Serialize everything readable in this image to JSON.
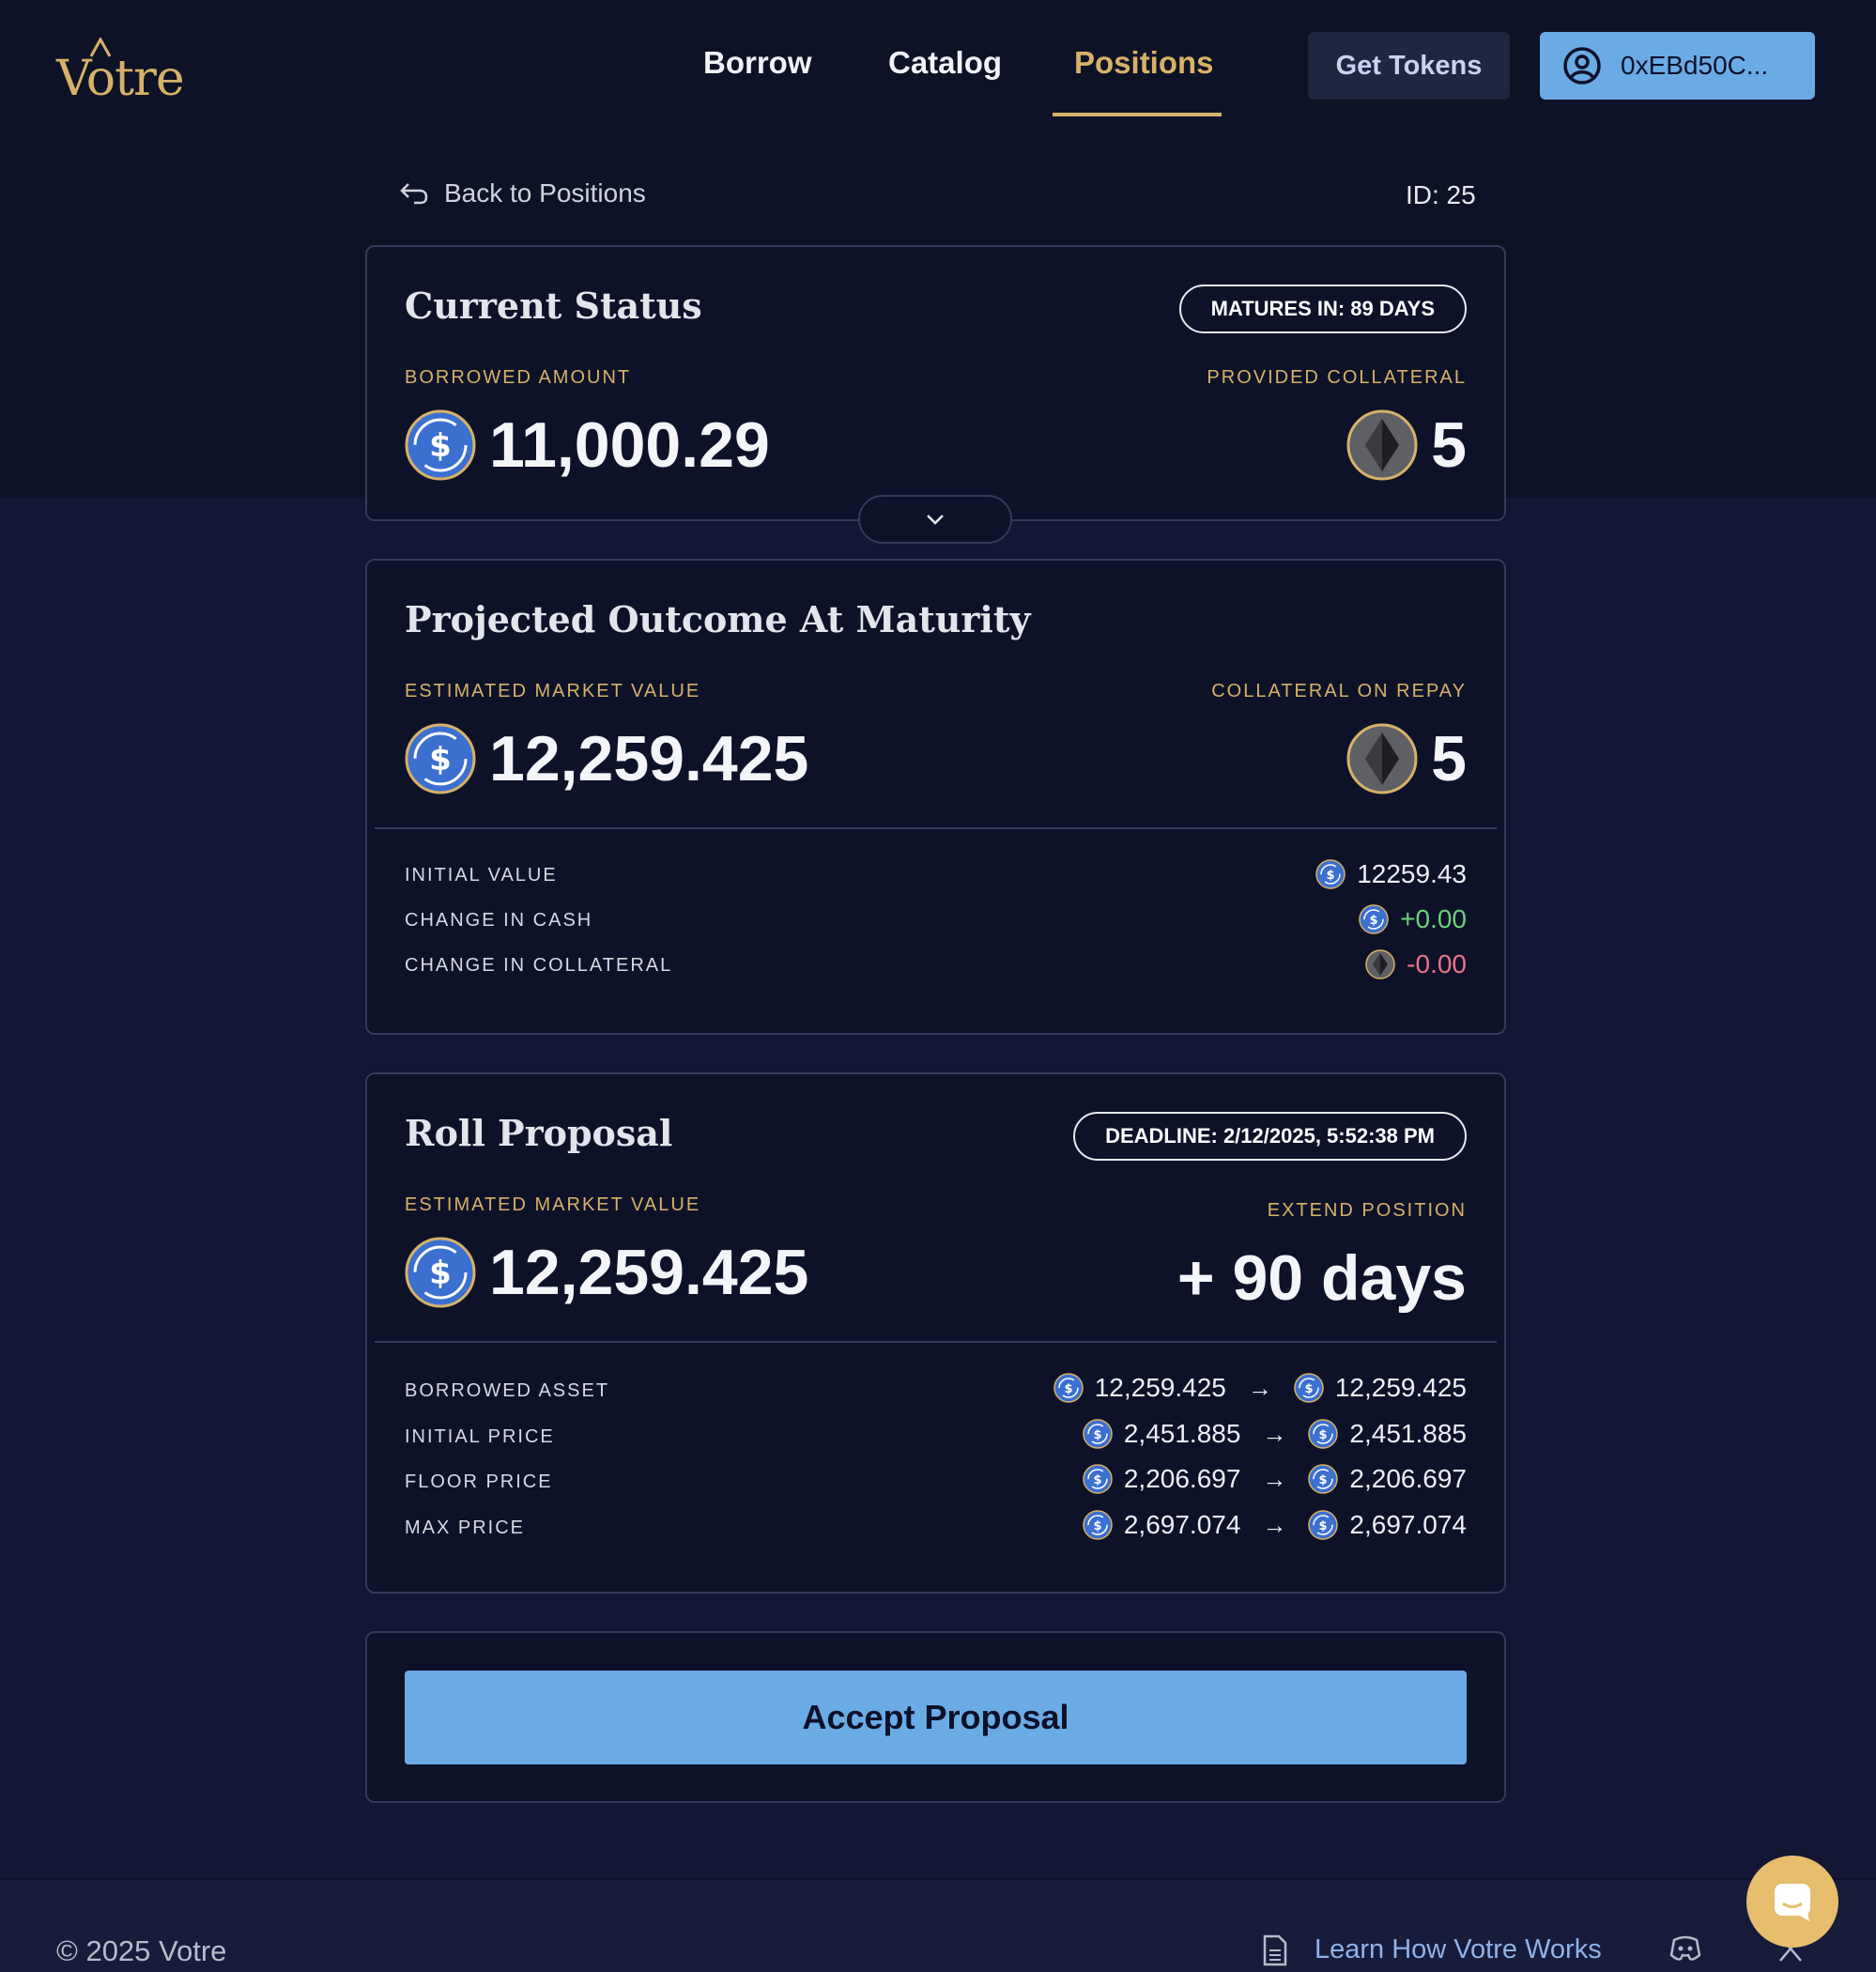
{
  "brand": {
    "logo_text": "Votre",
    "accent": "#d7b168"
  },
  "nav": {
    "items": [
      {
        "label": "Borrow"
      },
      {
        "label": "Catalog"
      },
      {
        "label": "Positions"
      }
    ],
    "active": "Positions",
    "get_tokens_label": "Get Tokens",
    "wallet_label": "0xEBd50C...",
    "wallet_icon": "user-circle-icon"
  },
  "back": {
    "label": "Back to Positions",
    "icon": "return-arrow-icon"
  },
  "position_id": "ID: 25",
  "current_status": {
    "title": "Current Status",
    "badge": "MATURES IN: 89 DAYS",
    "borrowed_label": "BORROWED AMOUNT",
    "borrowed_value": "11,000.29",
    "collateral_label": "PROVIDED COLLATERAL",
    "collateral_value": "5"
  },
  "projected": {
    "title": "Projected Outcome At Maturity",
    "market_label": "ESTIMATED MARKET VALUE",
    "market_value": "12,259.425",
    "collateral_label": "COLLATERAL ON REPAY",
    "collateral_value": "5",
    "rows": [
      {
        "label": "INITIAL VALUE",
        "value": "12259.43",
        "icon": "usdc-coin-icon"
      },
      {
        "label": "CHANGE IN CASH",
        "value": "+0.00",
        "icon": "usdc-coin-icon"
      },
      {
        "label": "CHANGE IN COLLATERAL",
        "value": "-0.00",
        "icon": "eth-coin-icon"
      }
    ]
  },
  "roll": {
    "title": "Roll Proposal",
    "badge": "DEADLINE: 2/12/2025, 5:52:38 PM",
    "market_label": "ESTIMATED MARKET VALUE",
    "market_value": "12,259.425",
    "extend_label": "EXTEND POSITION",
    "extend_value": "+ 90 days",
    "rows": [
      {
        "label": "BORROWED ASSET",
        "from": "12,259.425",
        "to": "12,259.425"
      },
      {
        "label": "INITIAL PRICE",
        "from": "2,451.885",
        "to": "2,451.885"
      },
      {
        "label": "FLOOR PRICE",
        "from": "2,206.697",
        "to": "2,206.697"
      },
      {
        "label": "MAX PRICE",
        "from": "2,697.074",
        "to": "2,697.074"
      }
    ],
    "arrow": "→"
  },
  "accept_label": "Accept Proposal",
  "footer": {
    "copyright": "© 2025 Votre",
    "learn_link": "Learn How Votre Works"
  },
  "colors": {
    "background": "#0d1128",
    "primary_button": "#6aabe5",
    "positive": "#6cd07a",
    "negative": "#e9758a"
  }
}
